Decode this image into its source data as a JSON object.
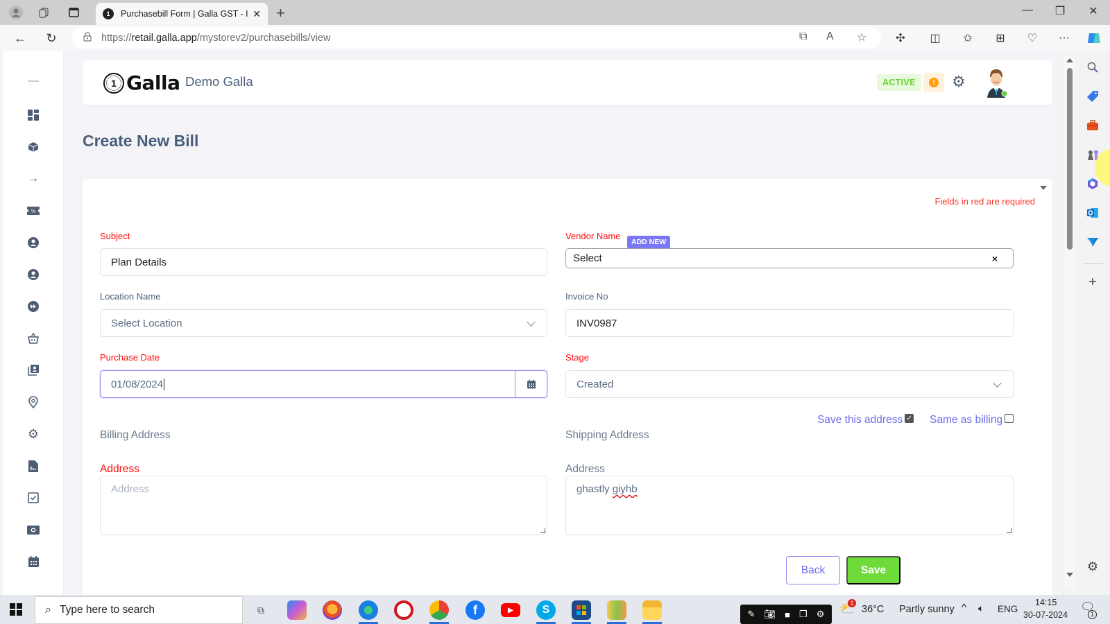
{
  "browser": {
    "tab_title": "Purchasebill Form | Galla GST - In",
    "url_host": "retail.galla.app",
    "url_prefix": "https://",
    "url_path": "/mystorev2/purchasebills/view",
    "icons": {
      "profile": "profile-icon",
      "workspaces": "workspaces-icon",
      "tab_actions": "tab-actions-icon",
      "new_tab": "+",
      "back": "←",
      "refresh": "↻",
      "minimize": "—",
      "restore": "❐",
      "close": "✕",
      "more": "···"
    }
  },
  "header": {
    "logo_coin": "1",
    "logo_text": "Galla",
    "store_name": "Demo Galla",
    "status_badge": "ACTIVE",
    "warning_glyph": "!"
  },
  "page": {
    "title": "Create New Bill",
    "required_note": "Fields in red are required"
  },
  "form": {
    "subject": {
      "label": "Subject",
      "value": "Plan Details"
    },
    "vendor": {
      "label": "Vendor Name",
      "add_new": "ADD NEW",
      "value": "Select",
      "clear": "×"
    },
    "location": {
      "label": "Location Name",
      "value": "Select Location"
    },
    "invoice": {
      "label": "Invoice No",
      "value": "INV0987"
    },
    "purchase_date": {
      "label": "Purchase Date",
      "value": "01/08/2024"
    },
    "stage": {
      "label": "Stage",
      "value": "Created"
    },
    "save_address": {
      "label": "Save this address",
      "checked": true
    },
    "same_as_billing": {
      "label": "Same as billing",
      "checked": false
    },
    "billing": {
      "section": "Billing Address",
      "address_label": "Address",
      "address_placeholder": "Address",
      "address_value": ""
    },
    "shipping": {
      "section": "Shipping Address",
      "address_label": "Address",
      "address_value_plain": "ghastly ",
      "address_value_misspelled": "giyhb"
    }
  },
  "actions": {
    "back": "Back",
    "save": "Save"
  },
  "colors": {
    "required_red": "#ff0b0b",
    "accent_purple": "#7b78f5",
    "save_green": "#6fdb3a",
    "active_green": "#69d02f",
    "warning_orange": "#ff9f10",
    "text_slate": "#4a5e79"
  },
  "sidebar": {
    "items": [
      "dashboard-icon",
      "product-box-icon",
      "arrow-right-icon",
      "discount-ticket-icon",
      "user-icon",
      "user-circle-icon",
      "fast-forward-icon",
      "basket-icon",
      "contacts-icon",
      "location-pin-icon",
      "settings-icon",
      "report-icon",
      "checkbox-icon",
      "cash-icon",
      "calendar-icon"
    ]
  },
  "taskbar": {
    "search_placeholder": "Type here to search",
    "weather_temp": "36°C",
    "weather_desc": "Partly sunny",
    "weather_badge": "1",
    "language": "ENG",
    "time": "14:15",
    "date": "30-07-2024",
    "notification_count": "1"
  }
}
